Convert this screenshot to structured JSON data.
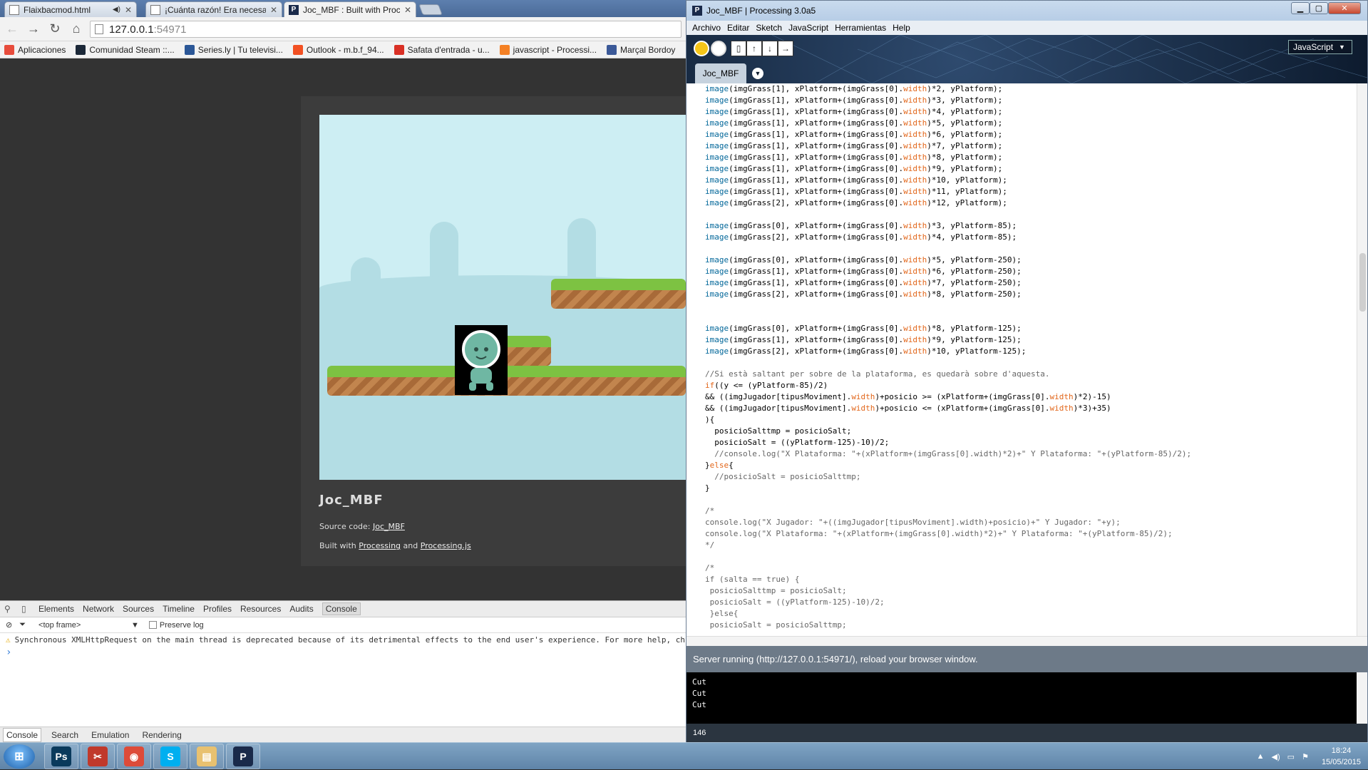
{
  "browser": {
    "tabs": [
      {
        "title": "Flaixbacmod.html",
        "active": false
      },
      {
        "title": "¡Cuánta razón! Era necesa",
        "active": false
      },
      {
        "title": "Joc_MBF : Built with Proce",
        "active": true
      }
    ],
    "address": {
      "host": "127.0.0.1",
      "port": ":54971"
    },
    "bookmarks": [
      {
        "label": "Aplicaciones",
        "icon": "apps-grid-icon",
        "color": "#e74c3c"
      },
      {
        "label": "Comunidad Steam ::...",
        "icon": "steam-icon",
        "color": "#1b2838"
      },
      {
        "label": "Series.ly | Tu televisi...",
        "icon": "seriesly-icon",
        "color": "#2b5797"
      },
      {
        "label": "Outlook - m.b.f_94...",
        "icon": "windows-icon",
        "color": "#f25022"
      },
      {
        "label": "Safata d'entrada - u...",
        "icon": "gmail-icon",
        "color": "#d93025"
      },
      {
        "label": "javascript - Processi...",
        "icon": "stackoverflow-icon",
        "color": "#f48024"
      },
      {
        "label": "Marçal Bordoy",
        "icon": "facebook-icon",
        "color": "#3b5998"
      }
    ],
    "sketch": {
      "title": "Joc_MBF",
      "source_prefix": "Source code: ",
      "source_link": "Joc_MBF",
      "built_prefix": "Built with ",
      "built_link1": "Processing",
      "built_and": " and ",
      "built_link2": "Processing.js"
    },
    "devtools": {
      "tabs": [
        "Elements",
        "Network",
        "Sources",
        "Timeline",
        "Profiles",
        "Resources",
        "Audits",
        "Console"
      ],
      "active_tab": "Console",
      "frame": "<top frame>",
      "preserve_log": "Preserve log",
      "message": "Synchronous XMLHttpRequest on the main thread is deprecated because of its detrimental effects to the end user's experience. For more help, ch",
      "prompt": "›",
      "drawer_tabs": [
        "Console",
        "Search",
        "Emulation",
        "Rendering"
      ]
    }
  },
  "pde": {
    "window_title": "Joc_MBF | Processing 3.0a5",
    "menu": [
      "Archivo",
      "Editar",
      "Sketch",
      "JavaScript",
      "Herramientas",
      "Help"
    ],
    "mode": "JavaScript",
    "sketch_tab": "Joc_MBF",
    "code_lines": [
      [
        [
          "kf",
          "image"
        ],
        [
          "nm",
          "(imgGrass[1], xPlatform+(imgGrass[0]."
        ],
        [
          "kw",
          "width"
        ],
        [
          "nm",
          ")*2, yPlatform);"
        ]
      ],
      [
        [
          "kf",
          "image"
        ],
        [
          "nm",
          "(imgGrass[1], xPlatform+(imgGrass[0]."
        ],
        [
          "kw",
          "width"
        ],
        [
          "nm",
          ")*3, yPlatform);"
        ]
      ],
      [
        [
          "kf",
          "image"
        ],
        [
          "nm",
          "(imgGrass[1], xPlatform+(imgGrass[0]."
        ],
        [
          "kw",
          "width"
        ],
        [
          "nm",
          ")*4, yPlatform);"
        ]
      ],
      [
        [
          "kf",
          "image"
        ],
        [
          "nm",
          "(imgGrass[1], xPlatform+(imgGrass[0]."
        ],
        [
          "kw",
          "width"
        ],
        [
          "nm",
          ")*5, yPlatform);"
        ]
      ],
      [
        [
          "kf",
          "image"
        ],
        [
          "nm",
          "(imgGrass[1], xPlatform+(imgGrass[0]."
        ],
        [
          "kw",
          "width"
        ],
        [
          "nm",
          ")*6, yPlatform);"
        ]
      ],
      [
        [
          "kf",
          "image"
        ],
        [
          "nm",
          "(imgGrass[1], xPlatform+(imgGrass[0]."
        ],
        [
          "kw",
          "width"
        ],
        [
          "nm",
          ")*7, yPlatform);"
        ]
      ],
      [
        [
          "kf",
          "image"
        ],
        [
          "nm",
          "(imgGrass[1], xPlatform+(imgGrass[0]."
        ],
        [
          "kw",
          "width"
        ],
        [
          "nm",
          ")*8, yPlatform);"
        ]
      ],
      [
        [
          "kf",
          "image"
        ],
        [
          "nm",
          "(imgGrass[1], xPlatform+(imgGrass[0]."
        ],
        [
          "kw",
          "width"
        ],
        [
          "nm",
          ")*9, yPlatform);"
        ]
      ],
      [
        [
          "kf",
          "image"
        ],
        [
          "nm",
          "(imgGrass[1], xPlatform+(imgGrass[0]."
        ],
        [
          "kw",
          "width"
        ],
        [
          "nm",
          ")*10, yPlatform);"
        ]
      ],
      [
        [
          "kf",
          "image"
        ],
        [
          "nm",
          "(imgGrass[1], xPlatform+(imgGrass[0]."
        ],
        [
          "kw",
          "width"
        ],
        [
          "nm",
          ")*11, yPlatform);"
        ]
      ],
      [
        [
          "kf",
          "image"
        ],
        [
          "nm",
          "(imgGrass[2], xPlatform+(imgGrass[0]."
        ],
        [
          "kw",
          "width"
        ],
        [
          "nm",
          ")*12, yPlatform);"
        ]
      ],
      [],
      [
        [
          "kf",
          "image"
        ],
        [
          "nm",
          "(imgGrass[0], xPlatform+(imgGrass[0]."
        ],
        [
          "kw",
          "width"
        ],
        [
          "nm",
          ")*3, yPlatform-85);"
        ]
      ],
      [
        [
          "kf",
          "image"
        ],
        [
          "nm",
          "(imgGrass[2], xPlatform+(imgGrass[0]."
        ],
        [
          "kw",
          "width"
        ],
        [
          "nm",
          ")*4, yPlatform-85);"
        ]
      ],
      [],
      [
        [
          "kf",
          "image"
        ],
        [
          "nm",
          "(imgGrass[0], xPlatform+(imgGrass[0]."
        ],
        [
          "kw",
          "width"
        ],
        [
          "nm",
          ")*5, yPlatform-250);"
        ]
      ],
      [
        [
          "kf",
          "image"
        ],
        [
          "nm",
          "(imgGrass[1], xPlatform+(imgGrass[0]."
        ],
        [
          "kw",
          "width"
        ],
        [
          "nm",
          ")*6, yPlatform-250);"
        ]
      ],
      [
        [
          "kf",
          "image"
        ],
        [
          "nm",
          "(imgGrass[1], xPlatform+(imgGrass[0]."
        ],
        [
          "kw",
          "width"
        ],
        [
          "nm",
          ")*7, yPlatform-250);"
        ]
      ],
      [
        [
          "kf",
          "image"
        ],
        [
          "nm",
          "(imgGrass[2], xPlatform+(imgGrass[0]."
        ],
        [
          "kw",
          "width"
        ],
        [
          "nm",
          ")*8, yPlatform-250);"
        ]
      ],
      [],
      [],
      [
        [
          "kf",
          "image"
        ],
        [
          "nm",
          "(imgGrass[0], xPlatform+(imgGrass[0]."
        ],
        [
          "kw",
          "width"
        ],
        [
          "nm",
          ")*8, yPlatform-125);"
        ]
      ],
      [
        [
          "kf",
          "image"
        ],
        [
          "nm",
          "(imgGrass[1], xPlatform+(imgGrass[0]."
        ],
        [
          "kw",
          "width"
        ],
        [
          "nm",
          ")*9, yPlatform-125);"
        ]
      ],
      [
        [
          "kf",
          "image"
        ],
        [
          "nm",
          "(imgGrass[2], xPlatform+(imgGrass[0]."
        ],
        [
          "kw",
          "width"
        ],
        [
          "nm",
          ")*10, yPlatform-125);"
        ]
      ],
      [],
      [
        [
          "cm",
          "//Si està saltant per sobre de la plataforma, es quedarà sobre d'aquesta."
        ]
      ],
      [
        [
          "kw",
          "if"
        ],
        [
          "nm",
          "((y <= (yPlatform-85)/2)"
        ]
      ],
      [
        [
          "nm",
          "&& ((imgJugador[tipusMoviment]."
        ],
        [
          "kw",
          "width"
        ],
        [
          "nm",
          ")+posicio >= (xPlatform+(imgGrass[0]."
        ],
        [
          "kw",
          "width"
        ],
        [
          "nm",
          ")*2)-15)"
        ]
      ],
      [
        [
          "nm",
          "&& ((imgJugador[tipusMoviment]."
        ],
        [
          "kw",
          "width"
        ],
        [
          "nm",
          ")+posicio <= (xPlatform+(imgGrass[0]."
        ],
        [
          "kw",
          "width"
        ],
        [
          "nm",
          ")*3)+35)"
        ]
      ],
      [
        [
          "nm",
          "){"
        ]
      ],
      [
        [
          "nm",
          "  posicioSalttmp = posicioSalt;"
        ]
      ],
      [
        [
          "nm",
          "  posicioSalt = ((yPlatform-125)-10)/2;"
        ]
      ],
      [
        [
          "cm",
          "  //console.log(\"X Plataforma: \"+(xPlatform+(imgGrass[0].width)*2)+\" Y Plataforma: \"+(yPlatform-85)/2);"
        ]
      ],
      [
        [
          "nm",
          "}"
        ],
        [
          "kw",
          "else"
        ],
        [
          "nm",
          "{"
        ]
      ],
      [
        [
          "cm",
          "  //posicioSalt = posicioSalttmp;"
        ]
      ],
      [
        [
          "nm",
          "}"
        ]
      ],
      [],
      [
        [
          "cm",
          "/*"
        ]
      ],
      [
        [
          "cm",
          "console.log(\"X Jugador: \"+((imgJugador[tipusMoviment].width)+posicio)+\" Y Jugador: \"+y);"
        ]
      ],
      [
        [
          "cm",
          "console.log(\"X Plataforma: \"+(xPlatform+(imgGrass[0].width)*2)+\" Y Plataforma: \"+(yPlatform-85)/2);"
        ]
      ],
      [
        [
          "cm",
          "*/"
        ]
      ],
      [],
      [
        [
          "cm",
          "/*"
        ]
      ],
      [
        [
          "cm",
          "if (salta == true) {"
        ]
      ],
      [
        [
          "cm",
          " posicioSalttmp = posicioSalt;"
        ]
      ],
      [
        [
          "cm",
          " posicioSalt = ((yPlatform-125)-10)/2;"
        ]
      ],
      [
        [
          "cm",
          " }else{"
        ]
      ],
      [
        [
          "cm",
          " posicioSalt = posicioSalttmp;"
        ]
      ]
    ],
    "status": "Server running (http://127.0.0.1:54971/), reload your browser window.",
    "console_lines": [
      "Cut",
      "Cut",
      "Cut"
    ],
    "line_number": "146"
  },
  "taskbar": {
    "apps": [
      {
        "name": "photoshop",
        "label": "Ps",
        "color": "#0a3a5c"
      },
      {
        "name": "snipping-tool",
        "label": "✂",
        "color": "#c0392b"
      },
      {
        "name": "chrome",
        "label": "◉",
        "color": "#dd4b39"
      },
      {
        "name": "skype",
        "label": "S",
        "color": "#00aff0"
      },
      {
        "name": "explorer",
        "label": "▤",
        "color": "#e8c170"
      },
      {
        "name": "processing",
        "label": "P",
        "color": "#1a2a4a"
      }
    ],
    "time": "18:24",
    "date": "15/05/2015"
  }
}
